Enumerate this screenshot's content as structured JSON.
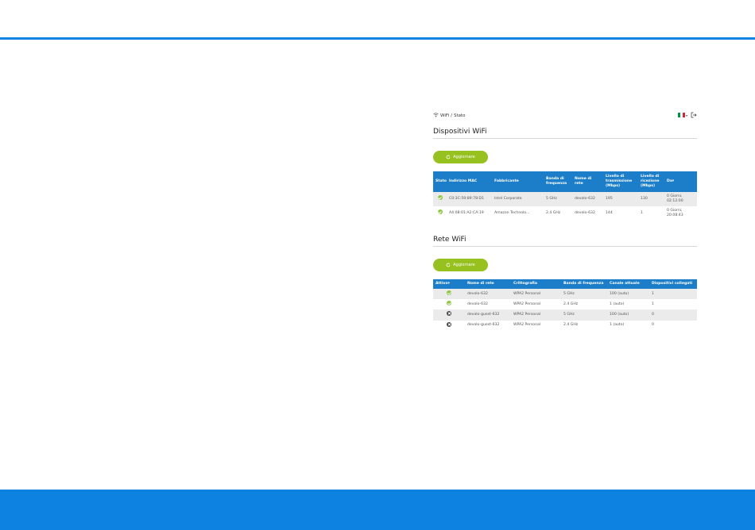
{
  "header": {
    "breadcrumb_section": "WiFi",
    "breadcrumb_separator": "/",
    "breadcrumb_page": "Stato"
  },
  "flag_colors": [
    "#009246",
    "#ffffff",
    "#ce2b37"
  ],
  "icons": {
    "breadcrumb": "wifi-icon",
    "language": "flag-it-icon",
    "logout": "logout-icon",
    "refresh": "refresh-icon"
  },
  "devices": {
    "title": "Dispositivi WiFi",
    "refresh_label": "Aggiornare",
    "columns": [
      "Stato",
      "Indirizzo MAC",
      "Fabbricante",
      "Banda di frequenza",
      "Nome di rete",
      "Livello di trasmissione (Mbps)",
      "Livello di ricezione (Mbps)",
      "Da▾"
    ],
    "rows": [
      {
        "status": "ok",
        "mac": "C0:3C:59:89:78:D1",
        "vendor": "Intel Corporate",
        "band": "5 GHz",
        "ssid": "devolo-632",
        "tx": "195",
        "rx": "130",
        "since": "0 Giorni, 02:12:00"
      },
      {
        "status": "ok",
        "mac": "A4:08:01:A2:CA:19",
        "vendor": "Amazon Technolo...",
        "band": "2.4 GHz",
        "ssid": "devolo-632",
        "tx": "144",
        "rx": "1",
        "since": "0 Giorni, 20:08:43"
      }
    ]
  },
  "networks": {
    "title": "Rete WiFi",
    "refresh_label": "Aggiornare",
    "columns": [
      "Attivo▾",
      "Nome di rete",
      "Crittografia",
      "Banda di frequenza",
      "Canale attuale",
      "Dispositivi collegati"
    ],
    "rows": [
      {
        "active": "ok",
        "ssid": "devolo-632",
        "encryption": "WPA2 Personal",
        "band": "5 GHz",
        "channel": "100 (auto)",
        "clients": "1"
      },
      {
        "active": "ok",
        "ssid": "devolo-632",
        "encryption": "WPA2 Personal",
        "band": "2.4 GHz",
        "channel": "1 (auto)",
        "clients": "1"
      },
      {
        "active": "off",
        "ssid": "devolo-guest-632",
        "encryption": "WPA2 Personal",
        "band": "5 GHz",
        "channel": "100 (auto)",
        "clients": "0"
      },
      {
        "active": "off",
        "ssid": "devolo-guest-632",
        "encryption": "WPA2 Personal",
        "band": "2.4 GHz",
        "channel": "1 (auto)",
        "clients": "0"
      }
    ]
  }
}
